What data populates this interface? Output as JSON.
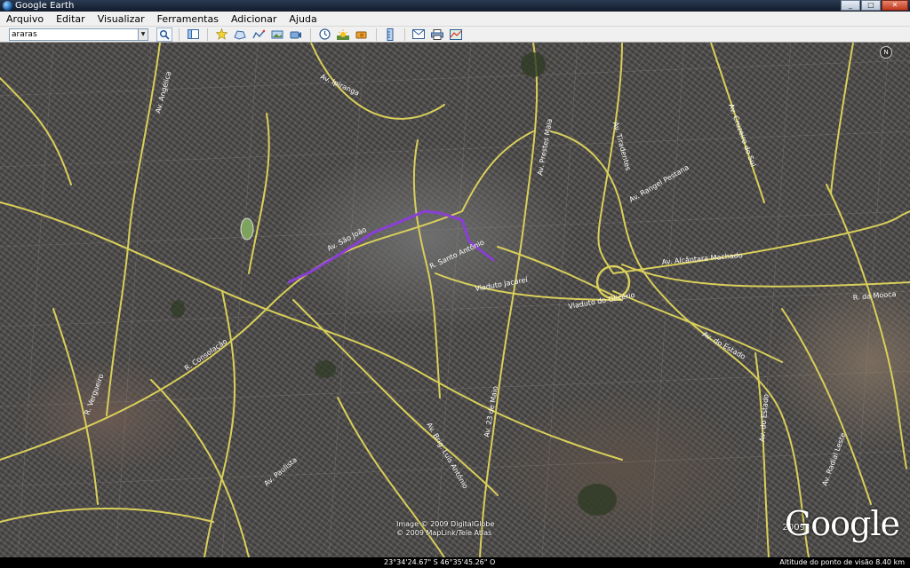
{
  "window": {
    "title": "Google Earth",
    "min": "_",
    "max": "□",
    "close": "✕"
  },
  "menu": [
    "Arquivo",
    "Editar",
    "Visualizar",
    "Ferramentas",
    "Adicionar",
    "Ajuda"
  ],
  "search": {
    "value": "araras"
  },
  "toolbar": {
    "icons": [
      "search-icon",
      "sidebar-icon",
      "placemark-icon",
      "polygon-icon",
      "path-icon",
      "image-overlay-icon",
      "record-tour-icon",
      "historical-imagery-icon",
      "sun-icon",
      "planets-icon",
      "ruler-icon",
      "email-icon",
      "print-icon",
      "maps-icon"
    ]
  },
  "map": {
    "labels": {
      "l1": "Av. Ipiranga",
      "l2": "Av. São João",
      "l3": "R. Santo Antônio",
      "l4": "Viaduto Jacareí",
      "l5": "Viaduto do Glicério",
      "l6": "Av. do Estado",
      "l7": "Av. Alcântara Machado",
      "l8": "R. da Mooca",
      "l9": "Av. Rangel Pestana",
      "l10": "Av. Prestes Maia",
      "l11": "Av. Tiradentes",
      "l12": "R. Vergueiro",
      "l13": "Av. Brig. Luís Antônio",
      "l14": "Av. 23 de Maio",
      "l15": "Av. Radial Leste",
      "l16": "Av. Cruzeiro do Sul",
      "l17": "Av. Angélica",
      "l18": "Av. Paulista",
      "l19": "R. Consolação",
      "l20": "Av. do Estado"
    },
    "compass": "N"
  },
  "credits": {
    "line1": "Image © 2009 DigitalGlobe",
    "line2": "© 2009 MapLink/Tele Atlas",
    "year": "2009",
    "logo": "Google"
  },
  "status": {
    "coords": "23°34'24.67\" S   46°35'45.26\" O",
    "altitude": "Altitude do ponto de visão   8.40 km"
  },
  "colors": {
    "roads": "#d9cf5a",
    "route": "#8a3fd6"
  }
}
